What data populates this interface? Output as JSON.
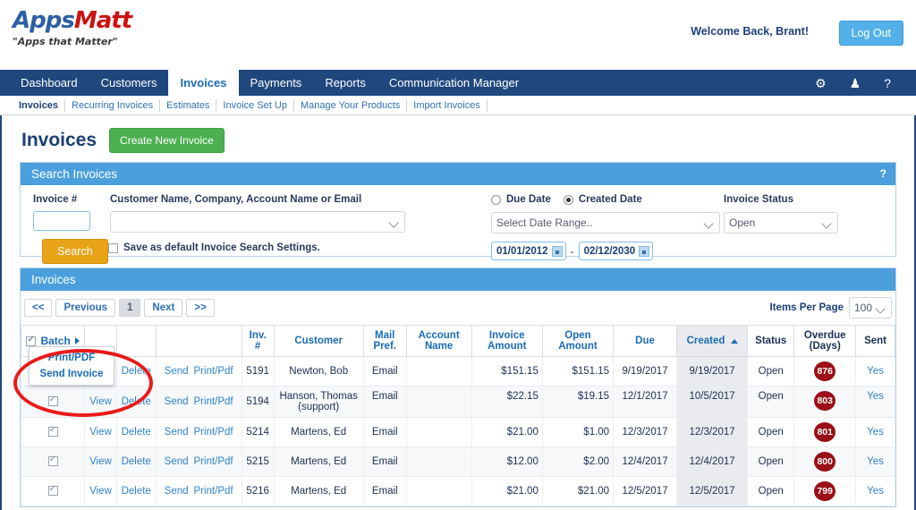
{
  "header": {
    "logo_first": "Apps",
    "logo_second": "Matt",
    "tagline": "\"Apps that Matter\"",
    "welcome": "Welcome Back, Brant!",
    "logout_label": "Log Out"
  },
  "mainnav": {
    "items": [
      {
        "label": "Dashboard",
        "active": false
      },
      {
        "label": "Customers",
        "active": false
      },
      {
        "label": "Invoices",
        "active": true
      },
      {
        "label": "Payments",
        "active": false
      },
      {
        "label": "Reports",
        "active": false
      },
      {
        "label": "Communication Manager",
        "active": false
      }
    ],
    "icons": [
      {
        "name": "gear-icon",
        "glyph": "⚙"
      },
      {
        "name": "user-icon",
        "glyph": "♟"
      },
      {
        "name": "help-icon",
        "glyph": "?"
      }
    ]
  },
  "subnav": {
    "items": [
      {
        "label": "Invoices",
        "active": true
      },
      {
        "label": "Recurring Invoices",
        "active": false
      },
      {
        "label": "Estimates",
        "active": false
      },
      {
        "label": "Invoice Set Up",
        "active": false
      },
      {
        "label": "Manage Your Products",
        "active": false
      },
      {
        "label": "Import Invoices",
        "active": false
      }
    ]
  },
  "page": {
    "title": "Invoices",
    "create_button": "Create New Invoice"
  },
  "search_panel": {
    "title": "Search Invoices",
    "help": "?",
    "invoice_no_label": "Invoice #",
    "invoice_no_value": "",
    "customer_label": "Customer Name, Company, Account Name or Email",
    "customer_value": "",
    "search_button": "Search",
    "save_default_label": "Save as default Invoice Search Settings.",
    "save_default_checked": false,
    "due_date_label": "Due Date",
    "created_date_label": "Created Date",
    "date_mode": "created",
    "date_range_value": "Select Date Range..",
    "status_label": "Invoice Status",
    "status_value": "Open",
    "date_from": "01/01/2012",
    "date_sep": "-",
    "date_to": "02/12/2030"
  },
  "invoices_panel": {
    "title": "Invoices",
    "pager": {
      "first": "<<",
      "previous": "Previous",
      "current": "1",
      "next": "Next",
      "last": ">>"
    },
    "items_per_page_label": "Items Per Page",
    "items_per_page_value": "100"
  },
  "batch": {
    "label": "Batch",
    "checked": true,
    "menu": [
      "Print/PDF",
      "Send Invoice"
    ]
  },
  "table": {
    "columns": [
      {
        "label": "",
        "dark": false
      },
      {
        "label": "",
        "dark": false
      },
      {
        "label": "",
        "dark": false
      },
      {
        "label": "",
        "dark": false
      },
      {
        "label": "Inv. #",
        "dark": false
      },
      {
        "label": "Customer",
        "dark": false
      },
      {
        "label": "Mail Pref.",
        "dark": false
      },
      {
        "label": "Account Name",
        "dark": false
      },
      {
        "label": "Invoice Amount",
        "dark": false
      },
      {
        "label": "Open Amount",
        "dark": false
      },
      {
        "label": "Due",
        "dark": false
      },
      {
        "label": "Created",
        "dark": false,
        "sorted": true,
        "sort_dir": "asc"
      },
      {
        "label": "Status",
        "dark": true
      },
      {
        "label": "Overdue (Days)",
        "dark": true
      },
      {
        "label": "Sent",
        "dark": true
      }
    ],
    "actions": [
      "View",
      "Delete",
      "Send",
      "Print/Pdf"
    ],
    "rows": [
      {
        "checked": true,
        "inv": "5191",
        "customer": "Newton, Bob",
        "mail": "Email",
        "account": "",
        "invoice_amount": "$151.15",
        "open_amount": "$151.15",
        "due": "9/19/2017",
        "created": "9/19/2017",
        "status": "Open",
        "overdue": "876",
        "sent": "Yes"
      },
      {
        "checked": true,
        "inv": "5194",
        "customer": "Hanson, Thomas (support)",
        "mail": "Email",
        "account": "",
        "invoice_amount": "$22.15",
        "open_amount": "$19.15",
        "due": "12/1/2017",
        "created": "10/5/2017",
        "status": "Open",
        "overdue": "803",
        "sent": "Yes"
      },
      {
        "checked": true,
        "inv": "5214",
        "customer": "Martens, Ed",
        "mail": "Email",
        "account": "",
        "invoice_amount": "$21.00",
        "open_amount": "$1.00",
        "due": "12/3/2017",
        "created": "12/3/2017",
        "status": "Open",
        "overdue": "801",
        "sent": "Yes"
      },
      {
        "checked": true,
        "inv": "5215",
        "customer": "Martens, Ed",
        "mail": "Email",
        "account": "",
        "invoice_amount": "$12.00",
        "open_amount": "$2.00",
        "due": "12/4/2017",
        "created": "12/4/2017",
        "status": "Open",
        "overdue": "800",
        "sent": "Yes"
      },
      {
        "checked": true,
        "inv": "5216",
        "customer": "Martens, Ed",
        "mail": "Email",
        "account": "",
        "invoice_amount": "$21.00",
        "open_amount": "$21.00",
        "due": "12/5/2017",
        "created": "12/5/2017",
        "status": "Open",
        "overdue": "799",
        "sent": "Yes"
      }
    ]
  },
  "colors": {
    "nav_blue": "#20477e",
    "panel_blue": "#4a9fdc",
    "accent_green": "#4caf50",
    "accent_orange": "#e8a317",
    "badge_red": "#9a0f18",
    "annotation_red": "#e81a1a",
    "link_blue": "#2f82c8"
  }
}
